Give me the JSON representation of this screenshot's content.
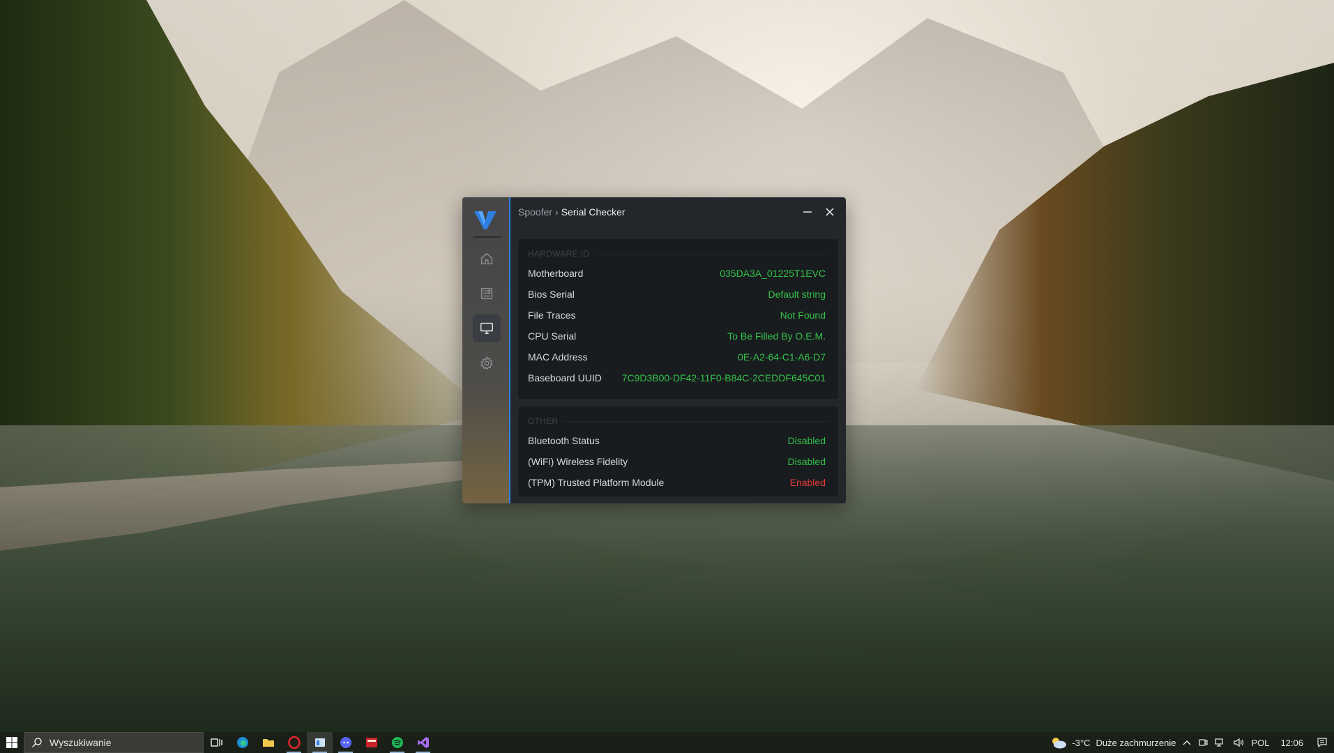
{
  "window": {
    "breadcrumb_root": "Spoofer",
    "breadcrumb_sep": "›",
    "breadcrumb_current": "Serial Checker"
  },
  "hardware": {
    "title": "HARDWARE ID",
    "rows": [
      {
        "label": "Motherboard",
        "value": "035DA3A_01225T1EVC"
      },
      {
        "label": "Bios Serial",
        "value": "Default string"
      },
      {
        "label": "File Traces",
        "value": "Not Found"
      },
      {
        "label": "CPU Serial",
        "value": "To Be Filled By O.E.M."
      },
      {
        "label": "MAC Address",
        "value": "0E-A2-64-C1-A6-D7"
      },
      {
        "label": "Baseboard UUID",
        "value": "7C9D3B00-DF42-11F0-B84C-2CEDDF645C01"
      }
    ]
  },
  "other": {
    "title": "OTHER",
    "rows": [
      {
        "label": "Bluetooth Status",
        "value": "Disabled"
      },
      {
        "label": "(WiFi) Wireless Fidelity",
        "value": "Disabled"
      },
      {
        "label": "(TPM) Trusted Platform Module",
        "value": "Enabled"
      }
    ]
  },
  "colors": {
    "accent": "#2f7fe0",
    "ok": "#33c24a",
    "bad": "#e63b3b"
  },
  "taskbar": {
    "search_placeholder": "Wyszukiwanie",
    "weather_temp": "-3°C",
    "weather_desc": "Duże zachmurzenie",
    "language": "POL",
    "time": "12:06"
  }
}
